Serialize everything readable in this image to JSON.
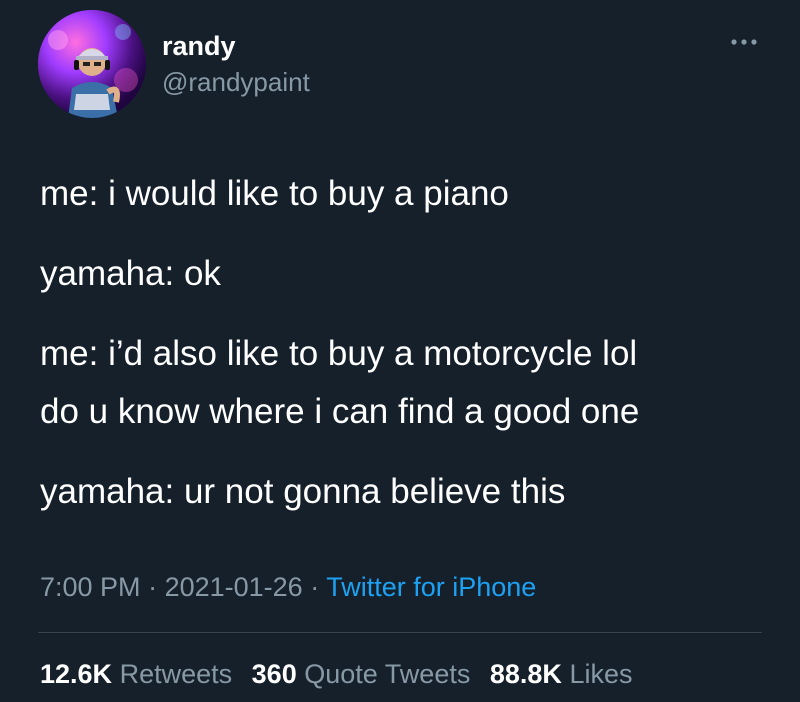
{
  "author": {
    "display_name": "randy",
    "handle": "@randypaint",
    "avatar_icon": "profile-avatar"
  },
  "tweet": {
    "lines": [
      "me: i would like to buy a piano",
      "yamaha: ok",
      "me: i’d also like to buy a motorcycle lol",
      "do u know where i can find a good one",
      "yamaha: ur not gonna believe this"
    ]
  },
  "meta": {
    "time": "7:00 PM",
    "separator": " · ",
    "date": "2021-01-26",
    "source": "Twitter for iPhone"
  },
  "stats": {
    "retweets_count": "12.6K",
    "retweets_label": "Retweets",
    "quotes_count": "360",
    "quotes_label": "Quote Tweets",
    "likes_count": "88.8K",
    "likes_label": "Likes"
  },
  "colors": {
    "background": "#15202b",
    "text": "#ffffff",
    "muted": "#8899a6",
    "link": "#1da1f2",
    "divider": "#38444d"
  }
}
